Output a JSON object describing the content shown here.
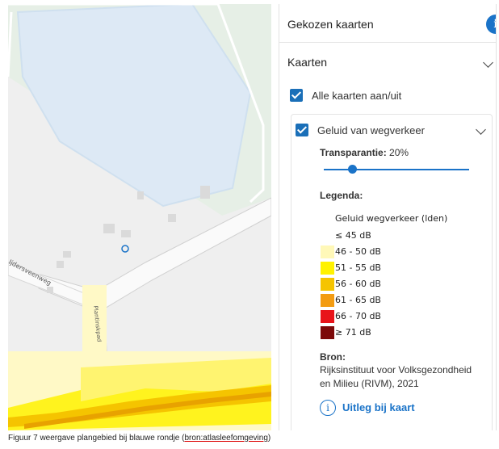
{
  "panel": {
    "title": "Gekozen kaarten",
    "info_badge": "i",
    "section_label": "Kaarten",
    "all_toggle_label": "Alle kaarten aan/uit",
    "layer": {
      "label": "Geluid van wegverkeer",
      "transparency_label": "Transparantie:",
      "transparency_value": "20%",
      "transparency_fraction": 0.2,
      "legend_heading": "Legenda:",
      "legend_title": "Geluid wegverkeer (lden)",
      "legend_items": [
        {
          "label": "≤ 45 dB",
          "color": ""
        },
        {
          "label": "46 - 50 dB",
          "color": "#fff8b8"
        },
        {
          "label": "51 - 55 dB",
          "color": "#fff200"
        },
        {
          "label": "56 - 60 dB",
          "color": "#f5c400"
        },
        {
          "label": "61 - 65 dB",
          "color": "#f39c12"
        },
        {
          "label": "66 - 70 dB",
          "color": "#e8141a"
        },
        {
          "label": "≥ 71 dB",
          "color": "#7d0a0a"
        }
      ],
      "source_heading": "Bron:",
      "source_line1": "Rijksinstituut voor Volksgezondheid",
      "source_line2": "en Milieu (RIVM), 2021",
      "explain_link": "Uitleg bij kaart",
      "info_icon": "i"
    }
  },
  "map": {
    "road_label_1": "Ijdersveenweg",
    "road_label_2": "Plantinskpad"
  },
  "caption": {
    "text": "Figuur 7 weergave plangebied bij blauwe rondje (",
    "link": "bron:atlasleefomgeving",
    "close": ")"
  },
  "colors": {
    "accent": "#1a73c8",
    "water": "#dce9f5"
  }
}
